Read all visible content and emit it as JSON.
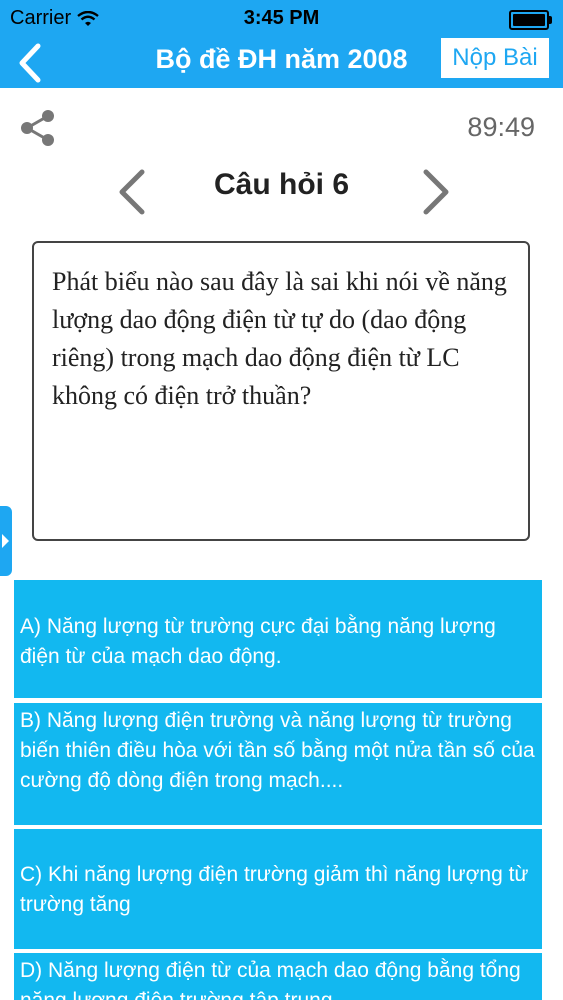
{
  "status_bar": {
    "carrier": "Carrier",
    "time": "3:45 PM"
  },
  "nav": {
    "title": "Bộ đề ĐH năm 2008",
    "submit_label": "Nộp Bài"
  },
  "timer": "89:49",
  "question": {
    "label": "Câu hỏi 6",
    "text": "Phát biểu nào sau đây là sai khi nói về năng lượng dao động điện từ tự do (dao động riêng) trong mạch dao động điện từ LC không có điện trở thuần?"
  },
  "answers": [
    {
      "text": "A) Năng lượng từ trường cực đại bằng năng lượng điện từ của mạch dao động."
    },
    {
      "text": "B) Năng lượng điện trường và năng lượng từ trường biến thiên điều hòa với tần số bằng một nửa tần số của cường độ dòng điện trong mạch...."
    },
    {
      "text": "C) Khi năng lượng điện trường giảm thì năng lượng từ trường tăng"
    },
    {
      "text": "D) Năng lượng điện từ của mạch dao động bằng tổng năng lượng điện trường tập trung"
    }
  ],
  "colors": {
    "accent": "#1ea7f2",
    "answer_bg": "#12b8f0"
  }
}
